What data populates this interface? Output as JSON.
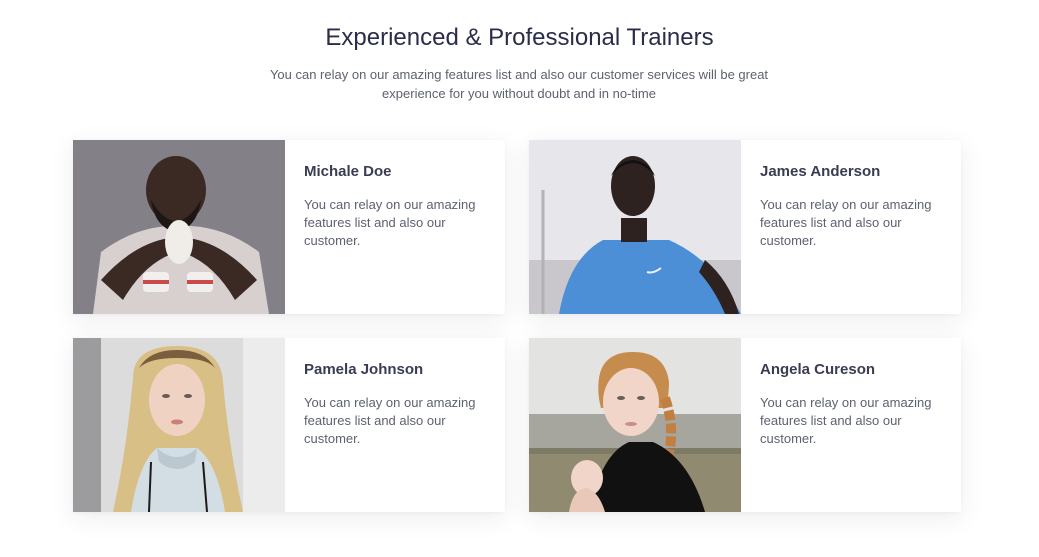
{
  "section": {
    "title": "Experienced & Professional Trainers",
    "subtitle": "You can relay on our amazing features list and also our customer services will be great experience for you without doubt and in no-time"
  },
  "trainers": [
    {
      "name": "Michale Doe",
      "description": "You can relay on our amazing features list and also our customer."
    },
    {
      "name": "James Anderson",
      "description": "You can relay on our amazing features list and also our customer."
    },
    {
      "name": "Pamela Johnson",
      "description": "You can relay on our amazing features list and also our customer."
    },
    {
      "name": "Angela Cureson",
      "description": "You can relay on our amazing features list and also our customer."
    }
  ],
  "colors": {
    "title": "#2a2d4a",
    "name": "#3a3d52",
    "body_text": "#5d6270",
    "card_background": "#ffffff"
  }
}
